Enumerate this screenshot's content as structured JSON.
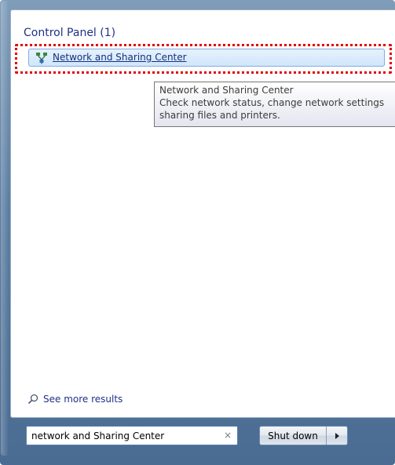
{
  "results": {
    "group_header": "Control Panel (1)",
    "item_label": "Network and Sharing Center",
    "item_icon": "network-icon"
  },
  "tooltip": {
    "line1": "Network and Sharing Center",
    "line2": "Check network status, change network settings",
    "line3": "sharing files and printers."
  },
  "see_more": {
    "label": "See more results",
    "icon": "magnifier-icon"
  },
  "search": {
    "value": "network and Sharing Center",
    "clear_glyph": "×"
  },
  "shutdown": {
    "label": "Shut down",
    "arrow_icon": "arrow-right-icon"
  },
  "colors": {
    "highlight": "#e00000",
    "accent_text": "#1e3287",
    "frame": "#5b7da1"
  }
}
